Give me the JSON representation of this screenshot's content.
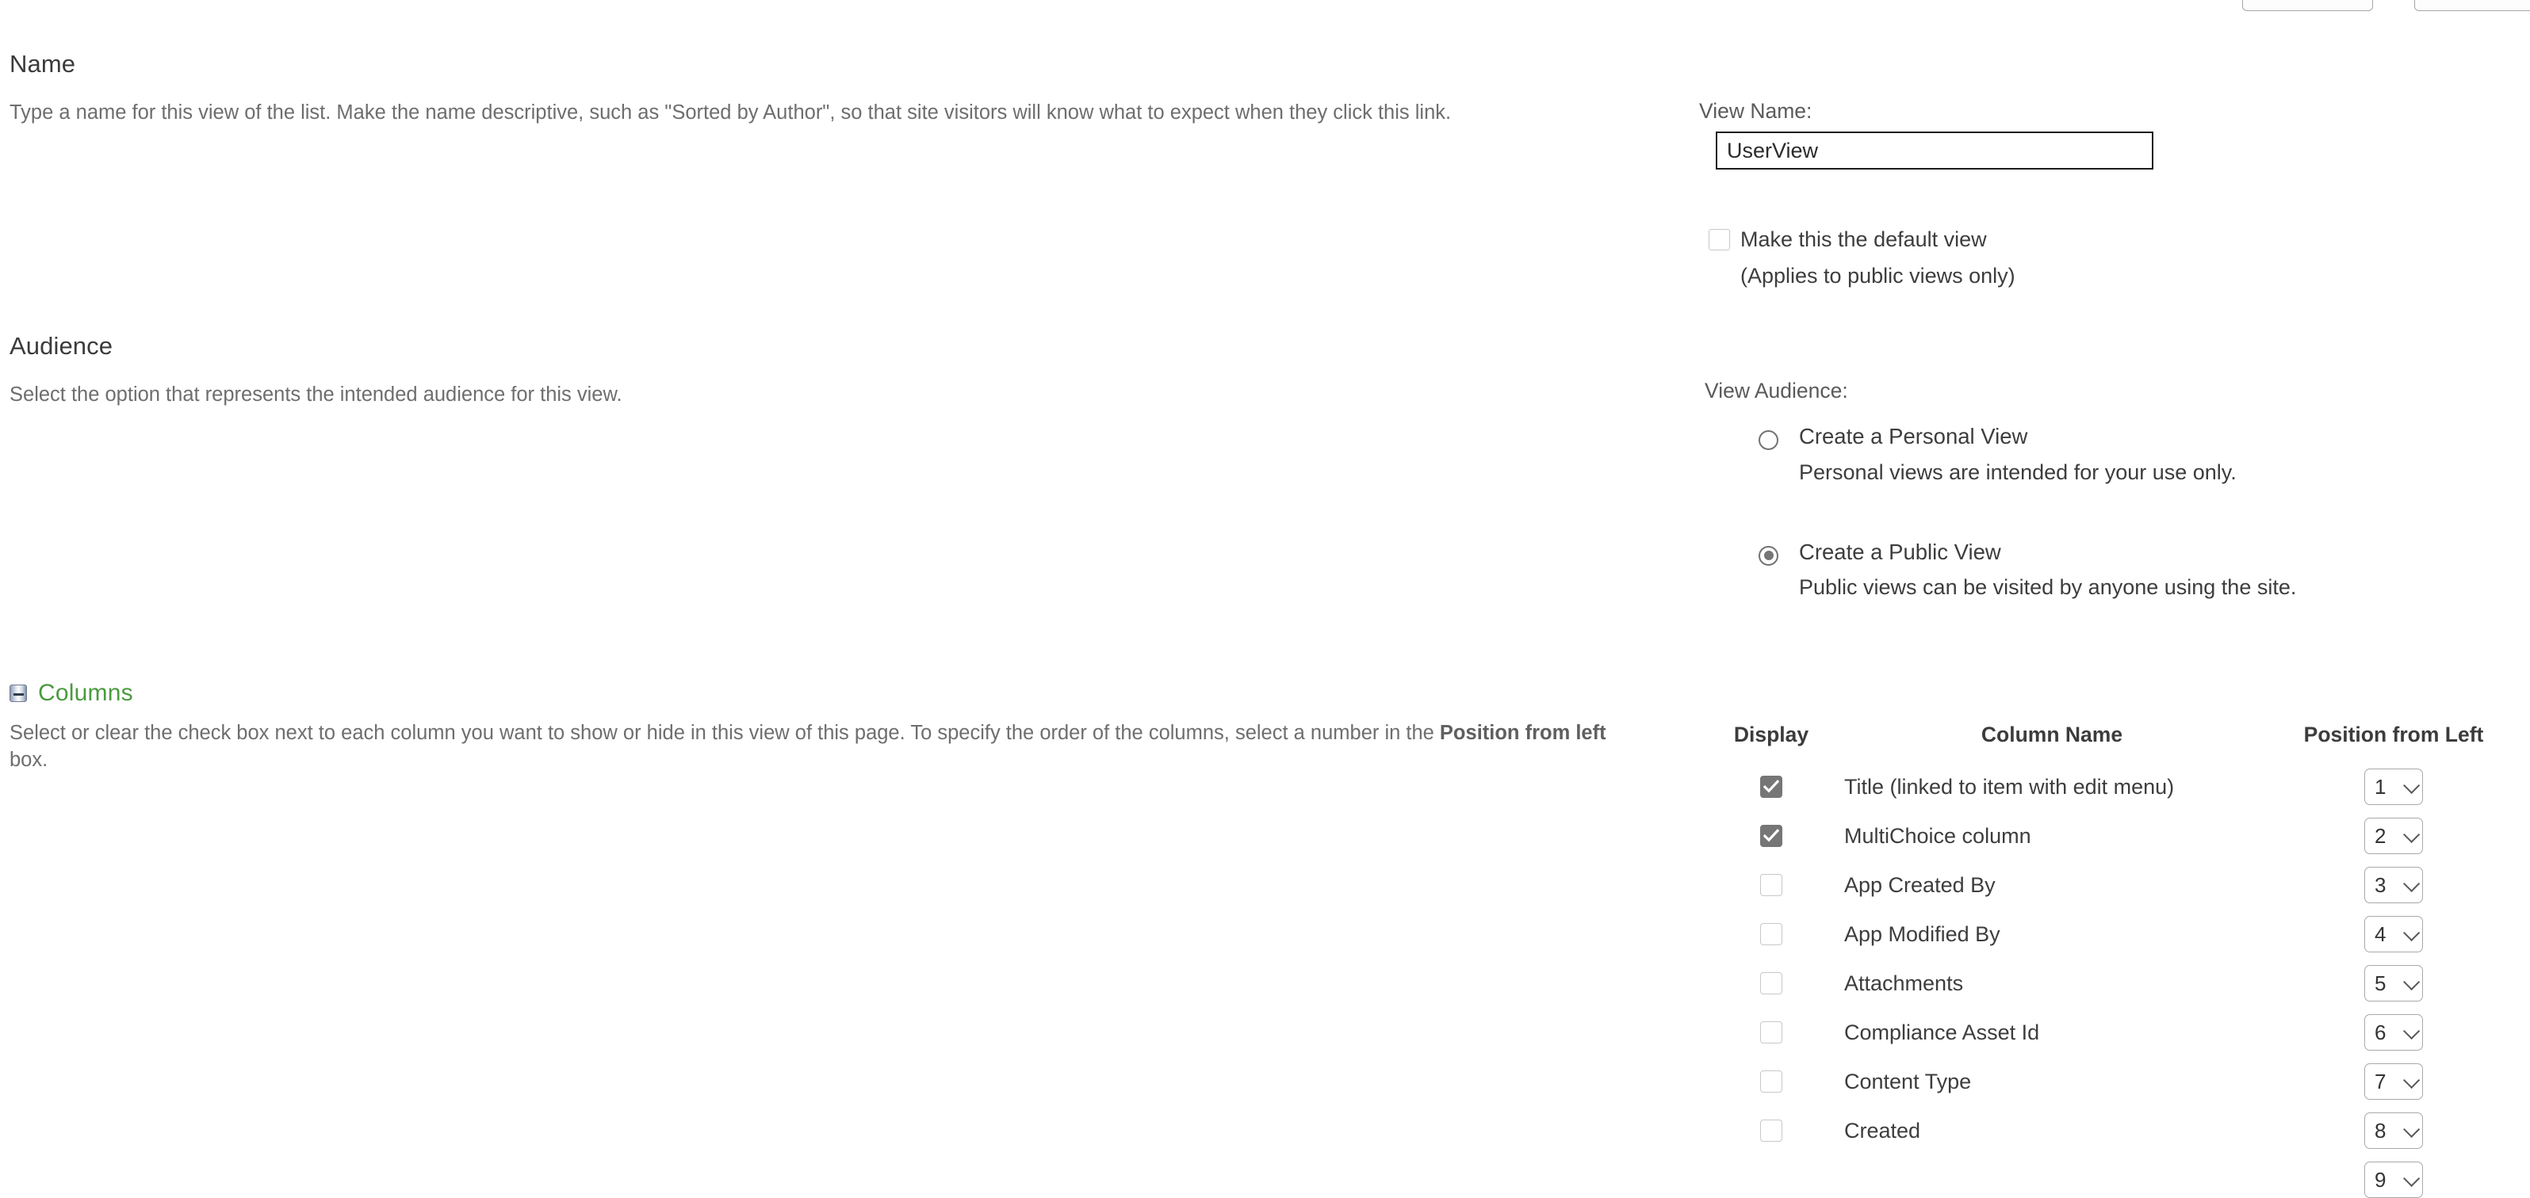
{
  "top_buttons": [
    {
      "label": ""
    },
    {
      "label": ""
    }
  ],
  "sections": {
    "name": {
      "title": "Name",
      "description": "Type a name for this view of the list. Make the name descriptive, such as \"Sorted by Author\", so that site visitors will know what to expect when they click this link."
    },
    "audience": {
      "title": "Audience",
      "description": "Select the option that represents the intended audience for this view."
    },
    "columns": {
      "title": "Columns",
      "collapse_icon": "collapse-minus-icon",
      "description_part1": "Select or clear the check box next to each column you want to show or hide in this view of this page. To specify the order of the columns, select a number in the ",
      "description_bold": "Position from left",
      "description_part2": " box."
    }
  },
  "view_name": {
    "label": "View Name:",
    "value": "UserView",
    "placeholder": ""
  },
  "default_view": {
    "label": "Make this the default view",
    "sublabel": "(Applies to public views only)",
    "checked": false
  },
  "view_audience": {
    "label": "View Audience:",
    "options": [
      {
        "label": "Create a Personal View",
        "description": "Personal views are intended for your use only.",
        "selected": false
      },
      {
        "label": "Create a Public View",
        "description": "Public views can be visited by anyone using the site.",
        "selected": true
      }
    ]
  },
  "columns_table": {
    "headers": [
      "Display",
      "Column Name",
      "Position from Left"
    ],
    "rows": [
      {
        "display": true,
        "name": "Title (linked to item with edit menu)",
        "position": "1"
      },
      {
        "display": true,
        "name": "MultiChoice column",
        "position": "2"
      },
      {
        "display": false,
        "name": "App Created By",
        "position": "3"
      },
      {
        "display": false,
        "name": "App Modified By",
        "position": "4"
      },
      {
        "display": false,
        "name": "Attachments",
        "position": "5"
      },
      {
        "display": false,
        "name": "Compliance Asset Id",
        "position": "6"
      },
      {
        "display": false,
        "name": "Content Type",
        "position": "7"
      },
      {
        "display": false,
        "name": "Created",
        "position": "8"
      }
    ],
    "clipped_next_position": "9"
  },
  "colors": {
    "section_title": "#3b3b3b",
    "body_text": "#6e6e6e",
    "columns_accent": "#4b9a3f",
    "checkbox_checked": "#767676",
    "radio_selected": "#767676",
    "input_border": "#1b1b1b"
  }
}
